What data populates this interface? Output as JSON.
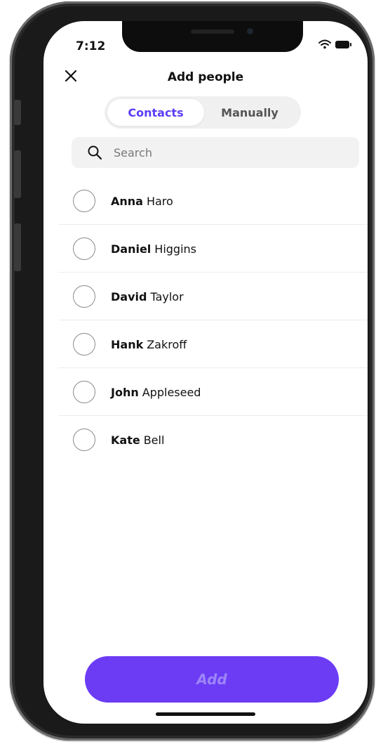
{
  "status_bar": {
    "time": "7:12",
    "wifi_icon": "wifi-icon",
    "battery_icon": "battery-icon"
  },
  "header": {
    "title": "Add people",
    "close_icon": "close-icon"
  },
  "tabs": [
    {
      "label": "Contacts",
      "selected": true
    },
    {
      "label": "Manually",
      "selected": false
    }
  ],
  "search": {
    "placeholder": "Search",
    "value": "",
    "icon": "search-icon"
  },
  "contacts": [
    {
      "first": "Anna",
      "last": "Haro",
      "checked": false
    },
    {
      "first": "Daniel",
      "last": "Higgins",
      "checked": false
    },
    {
      "first": "David",
      "last": "Taylor",
      "checked": false
    },
    {
      "first": "Hank",
      "last": "Zakroff",
      "checked": false
    },
    {
      "first": "John",
      "last": "Appleseed",
      "checked": false
    },
    {
      "first": "Kate",
      "last": "Bell",
      "checked": false
    }
  ],
  "add_button": {
    "label": "Add"
  },
  "colors": {
    "accent": "#6c3cf5",
    "tab_active_text": "#5b3df5",
    "add_label_disabled": "#9d85f7"
  }
}
